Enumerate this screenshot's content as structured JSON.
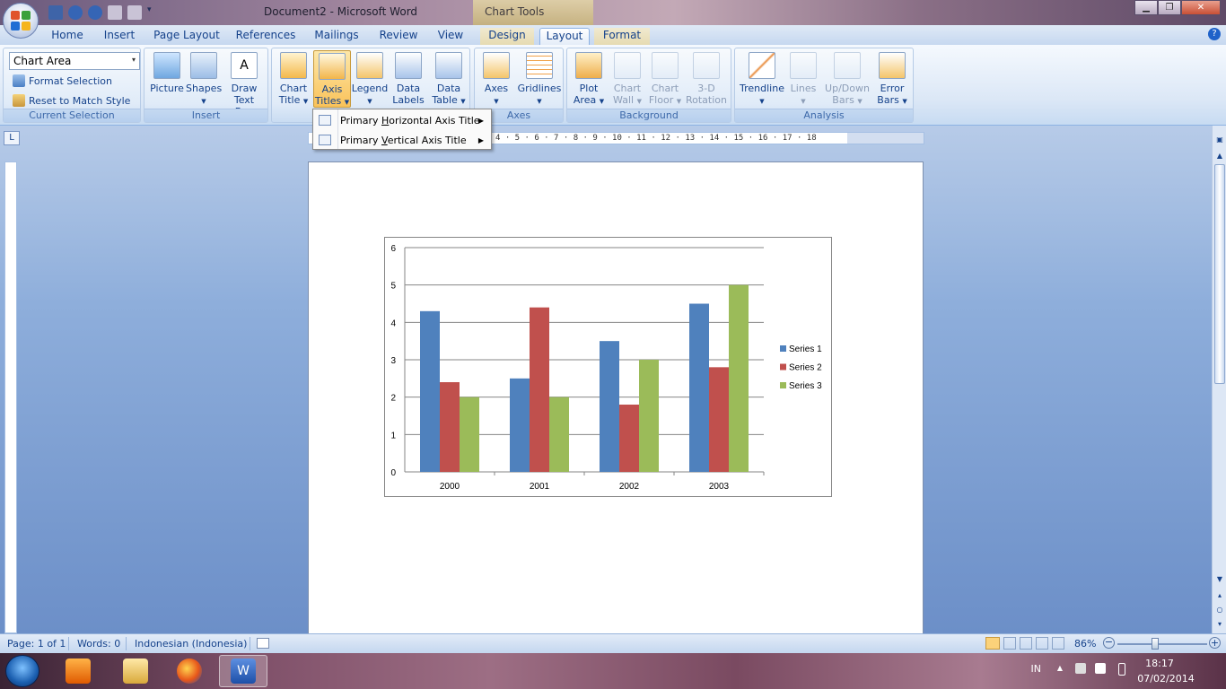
{
  "titlebar": {
    "document_title": "Document2 - Microsoft Word",
    "context_title": "Chart Tools"
  },
  "tabs": [
    {
      "label": "Home"
    },
    {
      "label": "Insert"
    },
    {
      "label": "Page Layout"
    },
    {
      "label": "References"
    },
    {
      "label": "Mailings"
    },
    {
      "label": "Review"
    },
    {
      "label": "View"
    },
    {
      "label": "Design"
    },
    {
      "label": "Layout"
    },
    {
      "label": "Format"
    }
  ],
  "active_tab": "Layout",
  "ribbon": {
    "current_selection": {
      "selector_value": "Chart Area",
      "format_selection": "Format Selection",
      "reset_style": "Reset to Match Style",
      "group_label": "Current Selection"
    },
    "insert": {
      "picture": "Picture",
      "shapes": "Shapes",
      "draw_text_box_1": "Draw",
      "draw_text_box_2": "Text Box",
      "group_label": "Insert"
    },
    "labels": {
      "chart_title_1": "Chart",
      "chart_title_2": "Title",
      "axis_titles_1": "Axis",
      "axis_titles_2": "Titles",
      "legend": "Legend",
      "data_labels_1": "Data",
      "data_labels_2": "Labels",
      "data_table_1": "Data",
      "data_table_2": "Table"
    },
    "axes": {
      "axes": "Axes",
      "gridlines": "Gridlines",
      "group_label": "Axes"
    },
    "background": {
      "plot_area_1": "Plot",
      "plot_area_2": "Area",
      "chart_wall_1": "Chart",
      "chart_wall_2": "Wall",
      "chart_floor_1": "Chart",
      "chart_floor_2": "Floor",
      "rotation_1": "3-D",
      "rotation_2": "Rotation",
      "group_label": "Background"
    },
    "analysis": {
      "trendline": "Trendline",
      "lines": "Lines",
      "updown_1": "Up/Down",
      "updown_2": "Bars",
      "error_1": "Error",
      "error_2": "Bars",
      "group_label": "Analysis"
    }
  },
  "dropdown": {
    "items": [
      {
        "prefix": "Primary ",
        "accel": "H",
        "rest": "orizontal Axis Title"
      },
      {
        "prefix": "Primary ",
        "accel": "V",
        "rest": "ertical Axis Title"
      }
    ]
  },
  "ruler": {
    "marks": "4 · 5 · 6 · 7 · 8 · 9 · 10 · 11 · 12 · 13 · 14 · 15 · 16 · 17 · 18"
  },
  "chart_data": {
    "type": "bar",
    "categories": [
      "2000",
      "2001",
      "2002",
      "2003"
    ],
    "series": [
      {
        "name": "Series 1",
        "values": [
          4.3,
          2.5,
          3.5,
          4.5
        ],
        "color": "#4f81bd"
      },
      {
        "name": "Series 2",
        "values": [
          2.4,
          4.4,
          1.8,
          2.8
        ],
        "color": "#c0504d"
      },
      {
        "name": "Series 3",
        "values": [
          2,
          2,
          3,
          5
        ],
        "color": "#9bbb59"
      }
    ],
    "ylim": [
      0,
      6
    ],
    "yticks": [
      "0",
      "1",
      "2",
      "3",
      "4",
      "5",
      "6"
    ],
    "grid": true,
    "legend": "right"
  },
  "statusbar": {
    "page": "Page: 1 of 1",
    "words": "Words: 0",
    "language": "Indonesian (Indonesia)",
    "zoom": "86%"
  },
  "tray": {
    "lang": "IN",
    "time": "18:17",
    "date": "07/02/2014"
  },
  "colors": {
    "ribbon_accent": "#15428b",
    "pressed": "#f9c25a"
  }
}
